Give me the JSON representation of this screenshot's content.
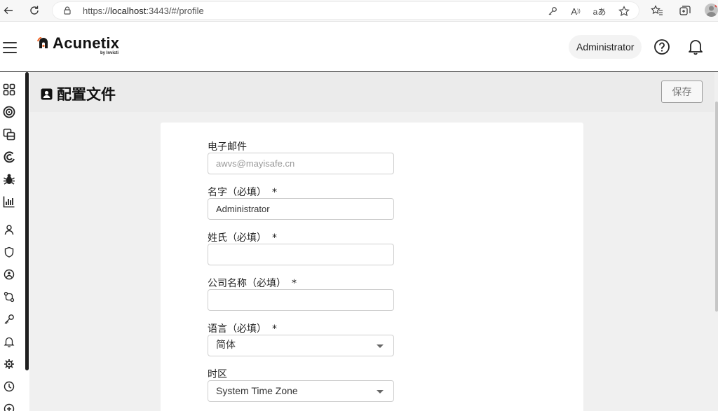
{
  "browser": {
    "url_prefix": "https://",
    "url_host": "localhost",
    "url_rest": ":3443/#/profile",
    "addr_icons": [
      "key-icon",
      "read-aloud-icon",
      "translate-icon",
      "favorite-star-icon"
    ],
    "toolbar_icons": [
      "favorites-icon",
      "collections-icon"
    ]
  },
  "header": {
    "logo_text": "Acunetix",
    "logo_sub": "by Invicti",
    "user_label": "Administrator"
  },
  "sidebar": {
    "icons": [
      "dashboard-icon",
      "targets-icon",
      "scans-icon",
      "acunetix-icon",
      "vulnerabilities-icon",
      "reports-icon",
      "users-icon",
      "shield-icon",
      "network-icon",
      "integrations-icon",
      "key-icon",
      "notifications-icon",
      "settings-icon",
      "history-icon",
      "more-icon"
    ]
  },
  "page": {
    "title": "配置文件",
    "save_label": "保存"
  },
  "form": {
    "email": {
      "label": "电子邮件",
      "placeholder": "awvs@mayisafe.cn"
    },
    "first_name": {
      "label": "名字（必填）",
      "required": "*",
      "value": "Administrator"
    },
    "last_name": {
      "label": "姓氏（必填）",
      "required": "*",
      "value": ""
    },
    "company": {
      "label": "公司名称（必填）",
      "required": "*",
      "value": ""
    },
    "language": {
      "label": "语言（必填）",
      "required": "*",
      "selected": "简体"
    },
    "timezone": {
      "label": "时区",
      "selected": "System Time Zone"
    }
  }
}
